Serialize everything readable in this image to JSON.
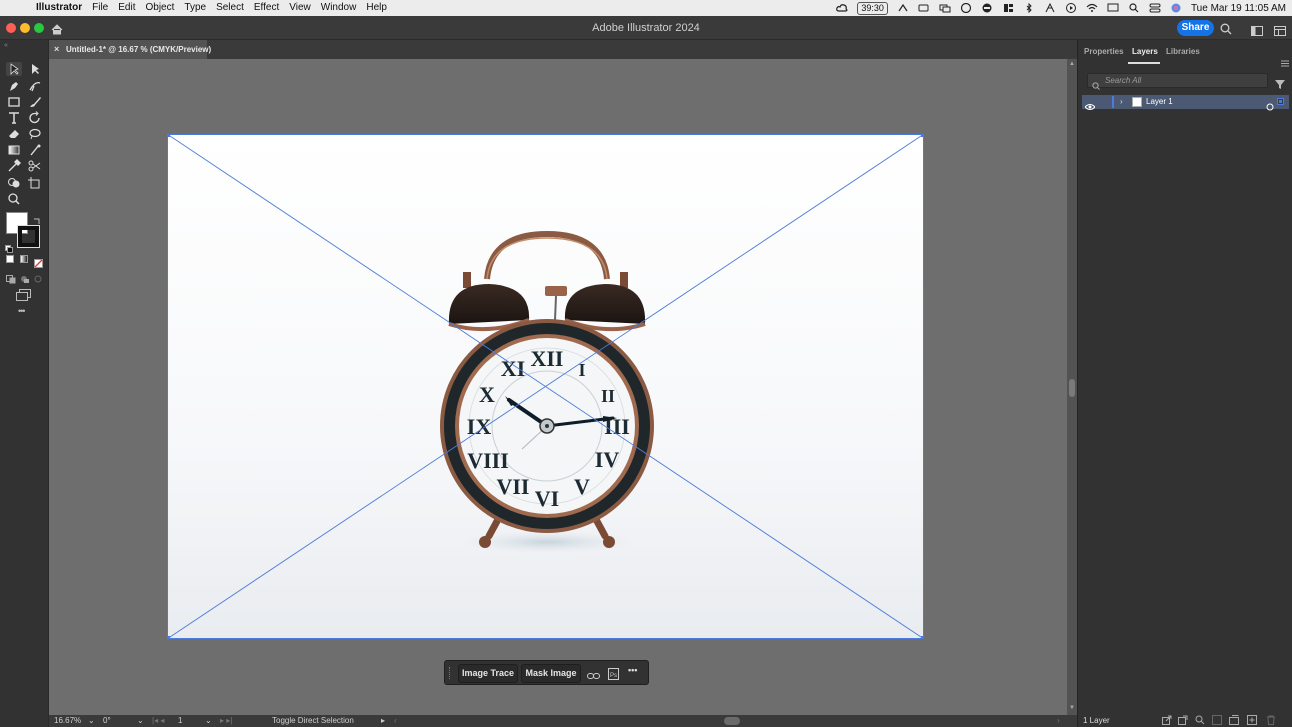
{
  "menubar": {
    "app_name": "Illustrator",
    "items": [
      "File",
      "Edit",
      "Object",
      "Type",
      "Select",
      "Effect",
      "View",
      "Window",
      "Help"
    ],
    "timer": "39:30",
    "clock": "Tue Mar 19  11:05 AM"
  },
  "window": {
    "title": "Adobe Illustrator 2024",
    "share_label": "Share"
  },
  "document": {
    "tab_title": "Untitled-1* @ 16.67 % (CMYK/Preview)",
    "tab_close": "×"
  },
  "taskbar": {
    "image_trace_label": "Image Trace",
    "mask_image_label": "Mask Image",
    "more_label": "•••"
  },
  "statusbar": {
    "zoom": "16.67%",
    "rotation": "0°",
    "artboard_number": "1",
    "status_text": "Toggle Direct Selection"
  },
  "right_panel": {
    "tabs": [
      "Properties",
      "Layers",
      "Libraries"
    ],
    "active_tab": "Layers",
    "search_placeholder": "Search All",
    "layers": [
      {
        "name": "Layer 1"
      }
    ],
    "layer_count": "1 Layer"
  },
  "toolbar": {
    "more_tools": "•••"
  },
  "colors": {
    "accent": "#1473e6",
    "selection": "#4b7bdc",
    "layer_highlight": "#4b5a72"
  }
}
